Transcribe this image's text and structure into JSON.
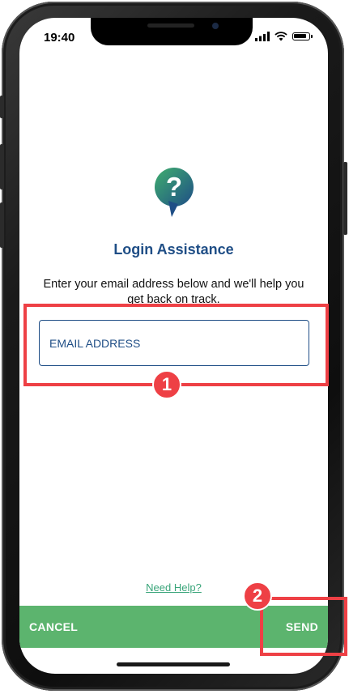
{
  "status_bar": {
    "time": "19:40"
  },
  "icon": "question-bubble-icon",
  "login": {
    "title": "Login Assistance",
    "instructions": "Enter your email address below and we'll help you get back on track.",
    "email_placeholder": "EMAIL ADDRESS",
    "email_value": "",
    "need_help": "Need Help?"
  },
  "actions": {
    "cancel": "CANCEL",
    "send": "SEND"
  },
  "annotations": [
    {
      "number": "1",
      "target": "email-field"
    },
    {
      "number": "2",
      "target": "send-button"
    }
  ],
  "colors": {
    "brand_blue": "#1f4e86",
    "action_green": "#5cb46e",
    "link_green": "#3aa57a",
    "annotation_red": "#ee4045"
  }
}
